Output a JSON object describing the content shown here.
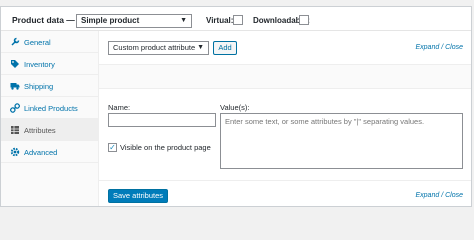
{
  "header": {
    "title": "Product data —",
    "product_type": "Simple product",
    "virtual_label": "Virtual:",
    "downloadable_label": "Downloadable:"
  },
  "sidebar": {
    "items": [
      {
        "label": "General",
        "icon": "wrench-icon"
      },
      {
        "label": "Inventory",
        "icon": "tag-icon"
      },
      {
        "label": "Shipping",
        "icon": "truck-icon"
      },
      {
        "label": "Linked Products",
        "icon": "link-icon"
      },
      {
        "label": "Attributes",
        "icon": "table-icon",
        "active": true
      },
      {
        "label": "Advanced",
        "icon": "gear-icon"
      }
    ]
  },
  "attributes": {
    "select_value": "Custom product attribute",
    "add_label": "Add",
    "expand_label": "Expand",
    "separator": "/",
    "close_label": "Close",
    "name_label": "Name:",
    "values_label": "Value(s):",
    "values_placeholder": "Enter some text, or some attributes by \"|\" separating values.",
    "visible_label": "Visible on the product page",
    "visible_checked": true,
    "save_label": "Save attributes"
  },
  "colors": {
    "accent": "#0073aa",
    "button_primary": "#007cba"
  }
}
